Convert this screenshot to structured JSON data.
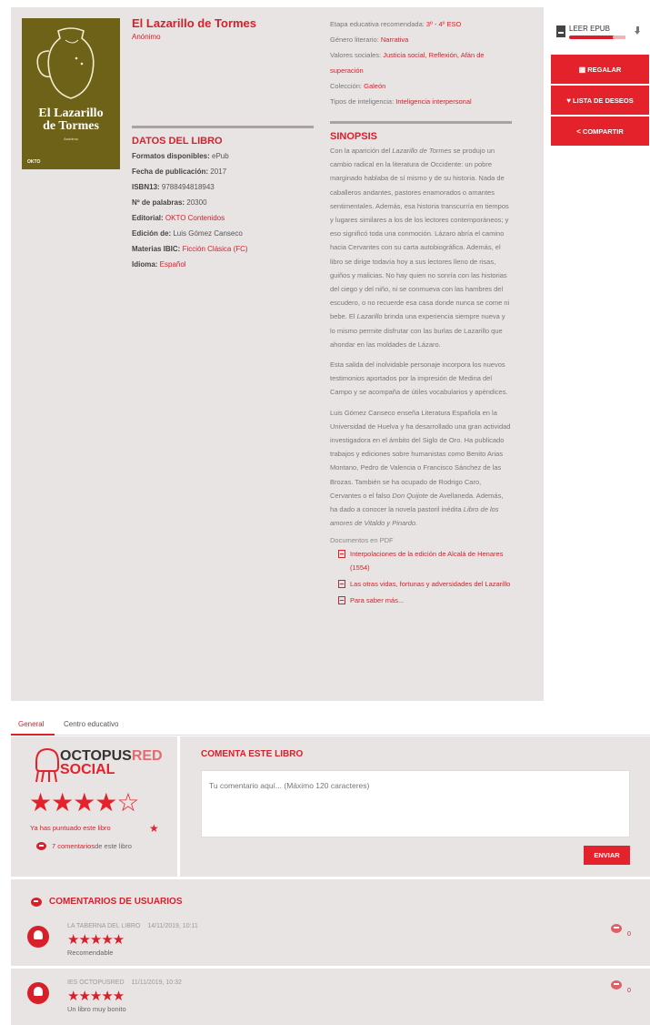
{
  "book": {
    "cover": {
      "title_line1": "El Lazarillo",
      "title_line2": "de Tormes",
      "author": "Anónimo",
      "publisher_logo": "OKTO",
      "color": "#6e6218"
    },
    "title": "El Lazarillo de Tormes",
    "author": "Anónimo",
    "meta": [
      {
        "label": "Etapa educativa recomendada: ",
        "value": "3º - 4º ESO"
      },
      {
        "label": "Género literario: ",
        "value": "Narrativa"
      },
      {
        "label": "Valores sociales: ",
        "value": "Justicia social, Reflexión, Afán de superación"
      },
      {
        "label": "Colección: ",
        "value": "Galeón"
      },
      {
        "label": "Tipos de inteligencia: ",
        "value": "Inteligencia interpersonal"
      }
    ],
    "details_title": "DATOS DEL LIBRO",
    "details": [
      {
        "label": "Formatos disponibles: ",
        "value": "ePub",
        "link": false
      },
      {
        "label": "Fecha de publicación: ",
        "value": "2017",
        "link": false
      },
      {
        "label": "ISBN13: ",
        "value": "9788494818943",
        "link": false
      },
      {
        "label": "Nº de palabras: ",
        "value": "20300",
        "link": false
      },
      {
        "label": "Editorial: ",
        "value": "OKTO Contenidos",
        "link": true
      },
      {
        "label": "Edición de: ",
        "value": "Luis Gómez Canseco",
        "link": false
      },
      {
        "label": "Materias IBIC: ",
        "value": "Ficción Clásica (FC)",
        "link": true
      },
      {
        "label": "Idioma: ",
        "value": "Español",
        "link": true
      }
    ],
    "synopsis_title": "SINOPSIS",
    "synopsis_p1_a": "Con la aparición del ",
    "synopsis_p1_em1": "Lazarillo de Tormes",
    "synopsis_p1_b": " se produjo un cambio radical en la literatura de Occidente: un pobre marginado hablaba de sí mismo y de su historia. Nada de caballeros andantes, pastores enamorados o amantes sentimentales. Además, esa historia transcurría en tiempos y lugares similares a los de los lectores contemporáneos; y eso significó toda una conmoción. Lázaro abría el camino hacia Cervantes con su carta autobiográfica. Además, el libro se dirige todavía hoy a sus lectores lleno de risas, guiños y malicias. No hay quien no sonría con las historias del ciego y del niño, ni se conmueva con las hambres del escudero, o no recuerde esa casa donde nunca se come ni bebe. El ",
    "synopsis_p1_em2": "Lazarillo",
    "synopsis_p1_c": " brinda una experiencia siempre nueva y lo mismo permite disfrutar con las burlas de Lazarillo que ahondar en las moldades de Lázaro.",
    "synopsis_p2": "Esta salida del inolvidable personaje incorpora los nuevos testimonios aportados por la impresión de Medina del Campo y se acompaña de útiles vocabularios y apéndices.",
    "synopsis_p3_a": "Luis Gómez Canseco enseña Literatura Española en la Universidad de Huelva y ha desarrollado una gran actividad investigadora en el ámbito del Siglo de Oro. Ha publicado trabajos y ediciones sobre humanistas como Benito Arias Montano, Pedro de Valencia o Francisco Sánchez de las Brozas. También se ha ocupado de Rodrigo Caro, Cervantes o el falso ",
    "synopsis_p3_em1": "Don Quijote",
    "synopsis_p3_b": " de Avellaneda. Además, ha dado a conocer la novela pastoril inédita ",
    "synopsis_p3_em2": "Libro de los amores de Vitaldo y Pinardo.",
    "pdf_title": "Documentos en PDF",
    "pdfs": [
      "Interpolaciones de la edición de Alcalá de Henares (1554)",
      "Las otras vidas, fortunas y adversidades del Lazarillo",
      "Para saber más..."
    ]
  },
  "actions": {
    "read_epub": "LEER EPUB",
    "gift": "REGALAR",
    "wishlist": "LISTA DE DESEOS",
    "share": "COMPARTIR",
    "accent": "#e3222b"
  },
  "tabs": {
    "general": "General",
    "school": "Centro educativo"
  },
  "social": {
    "brand_line1_dark": "OCTOPUS",
    "brand_line1_red": "RED",
    "brand_line2": "SOCIAL",
    "rating_stars": "★★★★",
    "rating_empty": "☆",
    "rating_value": 4,
    "rating_max": 5,
    "rated_text": "Ya has puntuado este libro",
    "rated_star": "★",
    "comments_link": "7 comentarios",
    "comments_suffix": " de este libro",
    "comment_title": "COMENTA ESTE LIBRO",
    "comment_placeholder": "Tu comentario aquí... (Máximo 120 caracteres)",
    "send": "ENVIAR",
    "users_title": "COMENTARIOS DE USUARIOS",
    "comments": [
      {
        "author": "LA TABERNA DEL LIBRO",
        "date": "14/11/2019, 10:11",
        "stars": "★★★★★",
        "text": "Recomendable",
        "count": "0"
      },
      {
        "author": "IES OCTOPUSRED",
        "date": "11/11/2019, 10:32",
        "stars": "★★★★★",
        "text": "Un libro muy bonito",
        "count": "0"
      }
    ]
  }
}
